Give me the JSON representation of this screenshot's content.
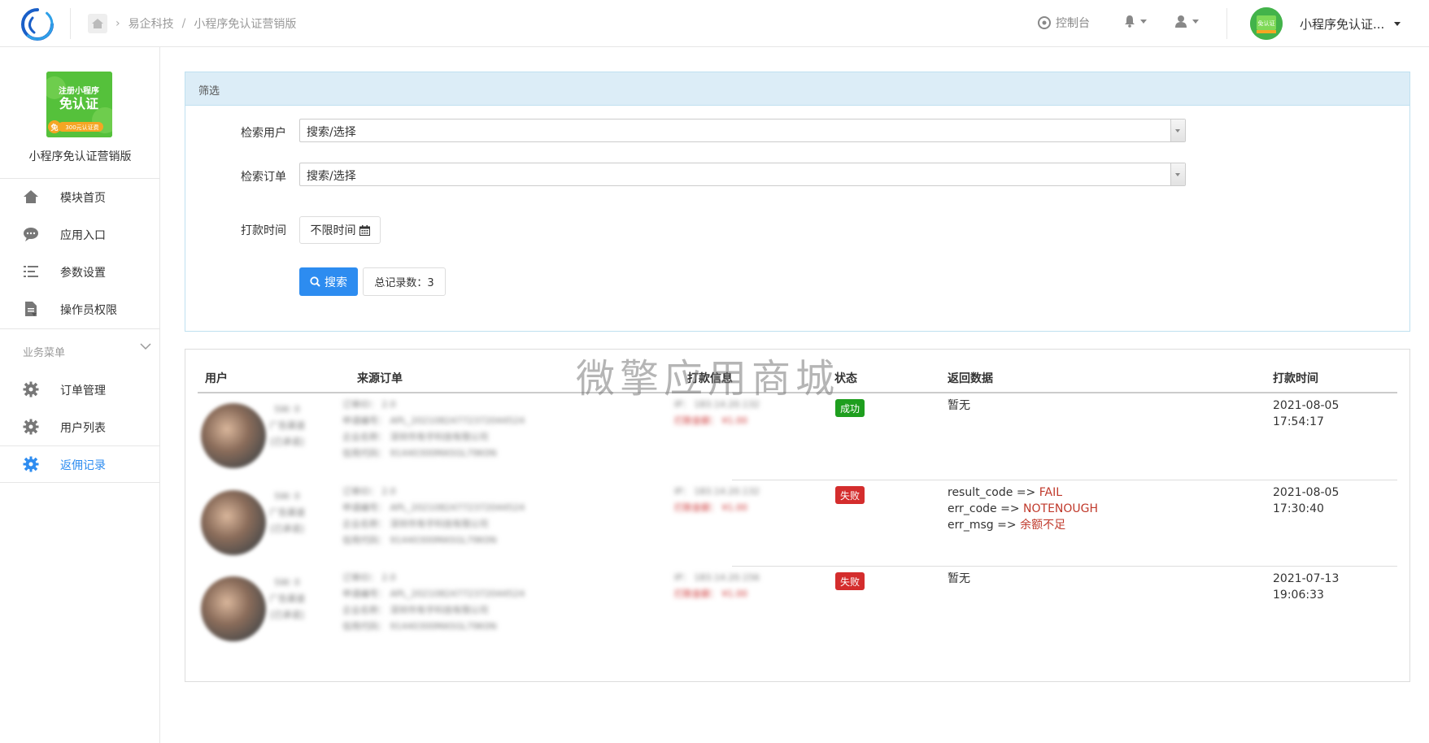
{
  "header": {
    "breadcrumb": [
      "易企科技",
      "小程序免认证营销版"
    ],
    "console_label": "控制台",
    "user_name": "小程序免认证..."
  },
  "sidebar": {
    "app_name": "小程序免认证营销版",
    "app_logo_text": [
      "注册小程序",
      "免认证",
      "免",
      "300元认证费"
    ],
    "items": [
      {
        "label": "模块首页",
        "icon": "home-icon"
      },
      {
        "label": "应用入口",
        "icon": "chat-icon"
      },
      {
        "label": "参数设置",
        "icon": "list-icon"
      },
      {
        "label": "操作员权限",
        "icon": "file-icon"
      }
    ],
    "group_title": "业务菜单",
    "group_items": [
      {
        "label": "订单管理",
        "icon": "gear-icon"
      },
      {
        "label": "用户列表",
        "icon": "gear-icon"
      },
      {
        "label": "返佣记录",
        "icon": "gear-icon",
        "active": true
      }
    ]
  },
  "filter": {
    "title": "筛选",
    "user_label": "检索用户",
    "user_value": "搜索/选择",
    "order_label": "检索订单",
    "order_value": "搜索/选择",
    "time_label": "打款时间",
    "time_value": "不限时间",
    "search_button": "搜索",
    "total_label": "总记录数：3"
  },
  "table": {
    "headers": [
      "用户",
      "来源订单",
      "打款信息",
      "状态",
      "返回数据",
      "打款时间"
    ],
    "rows": [
      {
        "user": [
          "SW: 0",
          "广告渠道",
          "[已承诺]"
        ],
        "order": [
          "订单ID： 2.0",
          "申请编号： APL_20210824772372044524",
          "企业名称： 深圳市有乎科技有限公司",
          "信用代码： 91440300MA5GL79K0N"
        ],
        "pay": [
          "IP： 183.14.20.132",
          "打款金额： ¥1.00"
        ],
        "status": "成功",
        "status_color": "#1e9e1e",
        "return_text": "暂无",
        "return_lines": [],
        "time": [
          "2021-08-05",
          "17:54:17"
        ]
      },
      {
        "user": [
          "SW: 0",
          "广告渠道",
          "[已承诺]"
        ],
        "order": [
          "订单ID： 2.0",
          "申请编号： APL_20210824772372044524",
          "企业名称： 深圳市有乎科技有限公司",
          "信用代码： 91440300MA5GL79K0N"
        ],
        "pay": [
          "IP： 183.14.20.132",
          "打款金额： ¥1.00"
        ],
        "status": "失败",
        "status_color": "#d42d2d",
        "return_text": "",
        "return_lines": [
          {
            "key": "result_code",
            "arrow": "=>",
            "value": "FAIL"
          },
          {
            "key": "err_code",
            "arrow": "=>",
            "value": "NOTENOUGH"
          },
          {
            "key": "err_msg",
            "arrow": "=>",
            "value": "余额不足"
          }
        ],
        "time": [
          "2021-08-05",
          "17:30:40"
        ]
      },
      {
        "user": [
          "SW: 0",
          "广告渠道",
          "[已承诺]"
        ],
        "order": [
          "订单ID： 2.0",
          "申请编号： APL_20210824772372044524",
          "企业名称： 深圳市有乎科技有限公司",
          "信用代码： 91440300MA5GL79K0N"
        ],
        "pay": [
          "IP： 183.14.20.156",
          "打款金额： ¥1.00"
        ],
        "status": "失败",
        "status_color": "#d42d2d",
        "return_text": "暂无",
        "return_lines": [],
        "time": [
          "2021-07-13",
          "19:06:33"
        ]
      }
    ]
  },
  "watermark": "微擎应用商城",
  "colors": {
    "accent": "#2d8cf0",
    "success": "#1e9e1e",
    "danger": "#d42d2d",
    "panel_head": "#dcedf7"
  }
}
